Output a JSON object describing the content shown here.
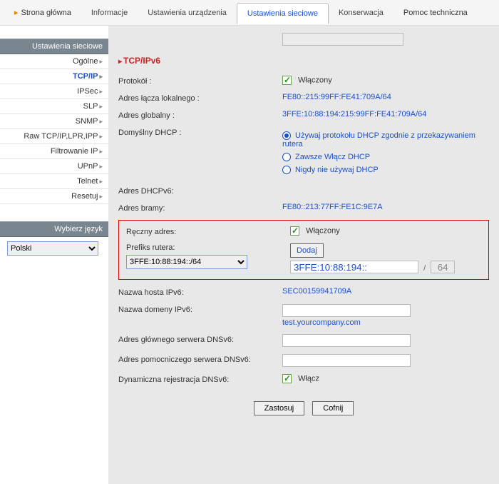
{
  "topnav": {
    "home": "Strona główna",
    "items": [
      "Informacje",
      "Ustawienia urządzenia",
      "Ustawienia sieciowe",
      "Konserwacja",
      "Pomoc techniczna"
    ],
    "activeIndex": 2
  },
  "sidebar": {
    "title": "Ustawienia sieciowe",
    "items": [
      "Ogólne",
      "TCP/IP",
      "IPSec",
      "SLP",
      "SNMP",
      "Raw TCP/IP,LPR,IPP",
      "Filtrowanie IP",
      "UPnP",
      "Telnet",
      "Resetuj"
    ],
    "activeIndex": 1,
    "langTitle": "Wybierz język",
    "langValue": "Polski"
  },
  "truncatedRow": {
    "value": ""
  },
  "section": {
    "title": "TCP/IPv6"
  },
  "fields": {
    "protocol": {
      "label": "Protokół :",
      "enabledText": "Włączony"
    },
    "linkLocal": {
      "label": "Adres łącza lokalnego :",
      "value": "FE80::215:99FF:FE41:709A/64"
    },
    "globalAddr": {
      "label": "Adres globalny :",
      "value": "3FFE:10:88:194:215:99FF:FE41:709A/64"
    },
    "dhcpDefault": {
      "label": "Domyślny DHCP :",
      "opts": [
        "Używaj protokołu DHCP zgodnie z przekazywaniem rutera",
        "Zawsze Włącz DHCP",
        "Nigdy nie używaj DHCP"
      ],
      "selected": 0
    },
    "dhcpv6Addr": {
      "label": "Adres DHCPv6:",
      "value": ""
    },
    "gateway": {
      "label": "Adres bramy:",
      "value": "FE80::213:77FF:FE1C:9E7A"
    },
    "manual": {
      "label": "Ręczny adres:",
      "enabledText": "Włączony"
    },
    "prefix": {
      "label": "Prefiks rutera:",
      "select": "3FFE:10:88:194::/64",
      "addBtn": "Dodaj",
      "input": "3FFE:10:88:194::",
      "cidr": "64"
    },
    "hostName": {
      "label": "Nazwa hosta IPv6:",
      "value": "SEC00159941709A"
    },
    "domainName": {
      "label": "Nazwa domeny IPv6:",
      "value": "",
      "hint": "test.yourcompany.com"
    },
    "dns1": {
      "label": "Adres głównego serwera DNSv6:",
      "value": ""
    },
    "dns2": {
      "label": "Adres pomocniczego serwera DNSv6:",
      "value": ""
    },
    "ddns": {
      "label": "Dynamiczna rejestracja DNSv6:",
      "enabledText": "Włącz"
    }
  },
  "buttons": {
    "apply": "Zastosuj",
    "undo": "Cofnij"
  }
}
